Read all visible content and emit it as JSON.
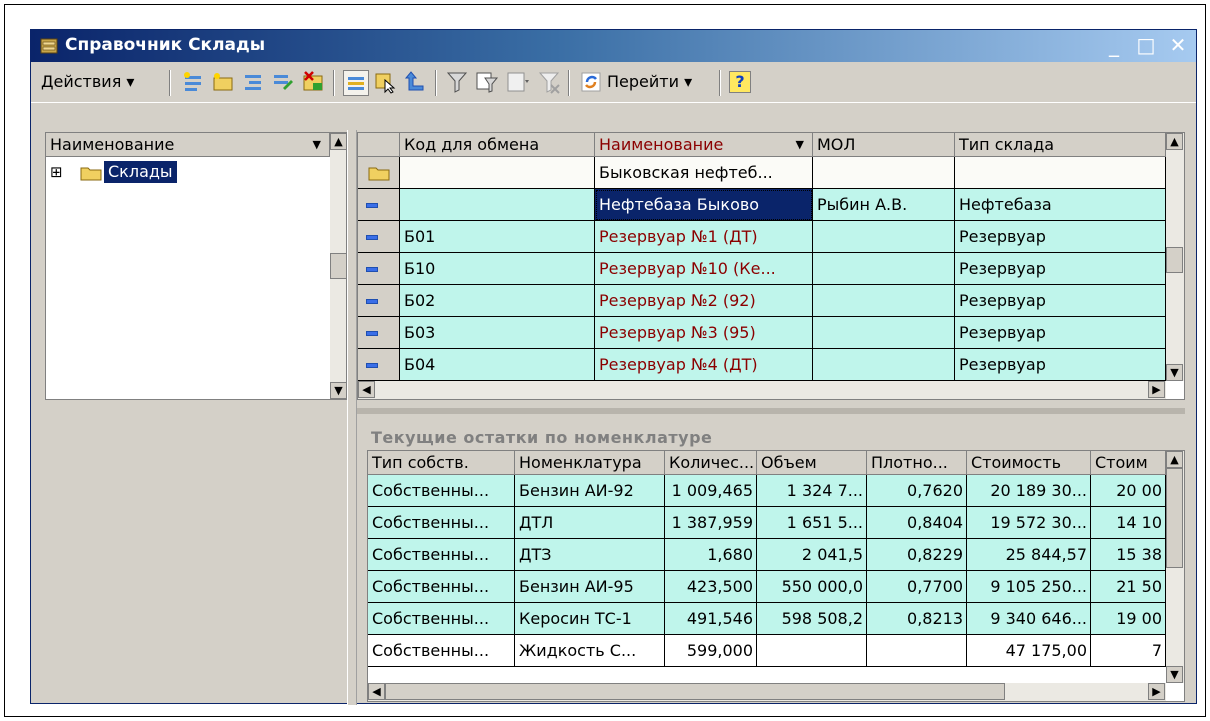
{
  "window": {
    "title": "Справочник Склады",
    "minimize": "_",
    "maximize": "□",
    "close": "✕"
  },
  "toolbar": {
    "actions_label": "Действия ▾",
    "goto_label": "Перейти ▾",
    "help_label": "?"
  },
  "tree": {
    "header": "Наименование",
    "items": [
      {
        "label": "Склады",
        "expander": "⊞"
      }
    ]
  },
  "grid": {
    "columns": [
      "Код для обмена",
      "Наименование",
      "МОЛ",
      "Тип склада"
    ],
    "rows": [
      {
        "code": "",
        "name": "Быковская нефтеб...",
        "mol": "",
        "type": "",
        "kind": "folder"
      },
      {
        "code": "",
        "name": "Нефтебаза Быково",
        "mol": "Рыбин А.В.",
        "type": "Нефтебаза",
        "kind": "item"
      },
      {
        "code": "Б01",
        "name": "Резервуар №1 (ДТ)",
        "mol": "",
        "type": "Резервуар",
        "kind": "item"
      },
      {
        "code": "Б10",
        "name": "Резервуар №10 (Ке...",
        "mol": "",
        "type": "Резервуар",
        "kind": "item"
      },
      {
        "code": "Б02",
        "name": "Резервуар №2 (92)",
        "mol": "",
        "type": "Резервуар",
        "kind": "item"
      },
      {
        "code": "Б03",
        "name": "Резервуар №3 (95)",
        "mol": "",
        "type": "Резервуар",
        "kind": "item"
      },
      {
        "code": "Б04",
        "name": "Резервуар №4 (ДТ)",
        "mol": "",
        "type": "Резервуар",
        "kind": "item"
      }
    ]
  },
  "stock": {
    "title": "Текущие остатки по номенклатуре",
    "columns": [
      "Тип собств.",
      "Номенклатура",
      "Количес...",
      "Объем",
      "Плотно...",
      "Стоимость",
      "Стоим"
    ],
    "rows": [
      [
        "Собственны...",
        "Бензин АИ-92",
        "1 009,465",
        "1 324 7...",
        "0,7620",
        "20 189 30...",
        "20 00"
      ],
      [
        "Собственны...",
        "ДТЛ",
        "1 387,959",
        "1 651 5...",
        "0,8404",
        "19 572 30...",
        "14 10"
      ],
      [
        "Собственны...",
        "ДТЗ",
        "1,680",
        "2 041,5",
        "0,8229",
        "25 844,57",
        "15 38"
      ],
      [
        "Собственны...",
        "Бензин АИ-95",
        "423,500",
        "550 000,0",
        "0,7700",
        "9 105 250...",
        "21 50"
      ],
      [
        "Собственны...",
        "Керосин ТС-1",
        "491,546",
        "598 508,2",
        "0,8213",
        "9 340 646...",
        "19 00"
      ],
      [
        "Собственны...",
        "Жидкость С...",
        "599,000",
        "",
        "",
        "47 175,00",
        "7"
      ]
    ]
  },
  "colors": {
    "row_bg": "#bff5eb",
    "selected_bg": "#0a246a",
    "name_red": "#8b0000"
  }
}
